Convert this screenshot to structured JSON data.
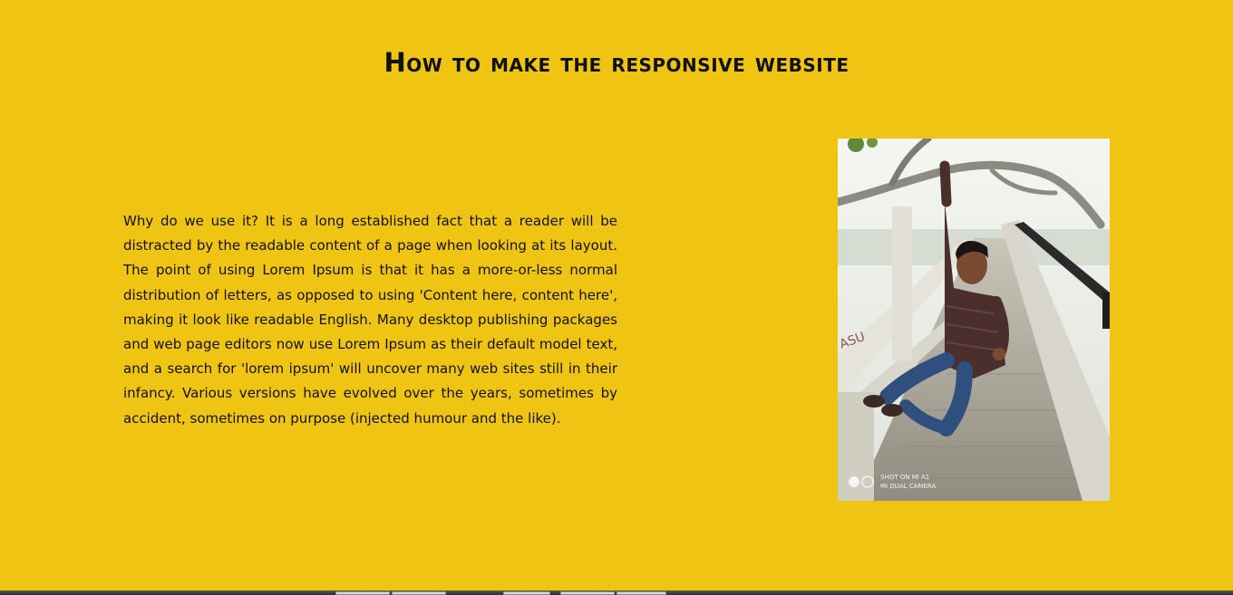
{
  "page": {
    "title": "How to make the responsive website",
    "body_text": "Why do we use it? It is a long established fact that a reader will be distracted by the readable content of a page when looking at its layout. The point of using Lorem Ipsum is that it has a more-or-less normal distribution of letters, as opposed to using 'Content here, content here', making it look like readable English. Many desktop publishing packages and web page editors now use Lorem Ipsum as their default model text, and a search for 'lorem ipsum' will uncover many web sites still in their infancy. Various versions have evolved over the years, sometimes by accident, sometimes on purpose (injected humour and the like)."
  },
  "photo": {
    "watermark_line1": "SHOT ON MI A1",
    "watermark_line2": "MI DUAL CAMERA"
  },
  "colors": {
    "background": "#f0c413",
    "text": "#111111"
  }
}
